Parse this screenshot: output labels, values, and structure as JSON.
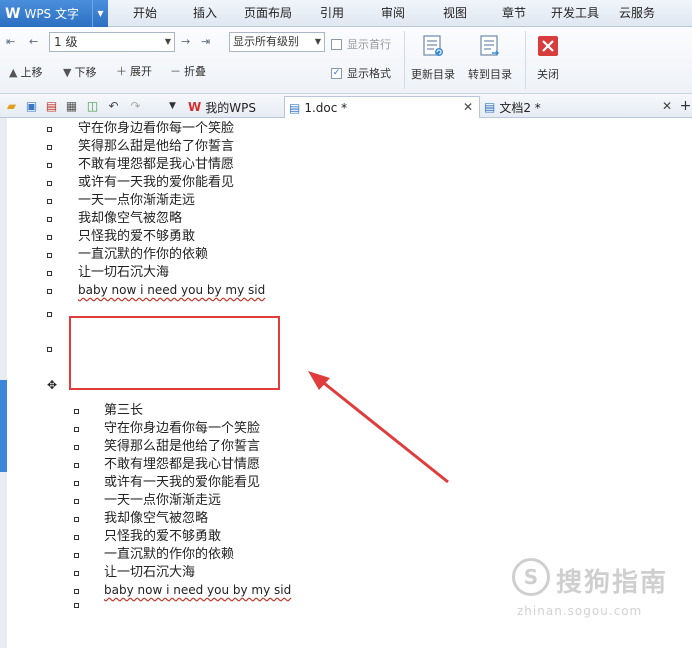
{
  "app": {
    "logo": "W",
    "title": "WPS 文字"
  },
  "menu": [
    "开始",
    "插入",
    "页面布局",
    "引用",
    "审阅",
    "视图",
    "章节",
    "开发工具",
    "云服务"
  ],
  "ribbon": {
    "level_value": "1 级",
    "show_level_value": "显示所有级别",
    "show_first_line": "显示首行",
    "show_format": "显示格式",
    "move_up": "上移",
    "move_down": "下移",
    "expand": "展开",
    "collapse": "折叠",
    "update_toc": "更新目录",
    "goto_toc": "转到目录",
    "close": "关闭"
  },
  "tabs": {
    "my_wps": "我的WPS",
    "doc1": "1.doc *",
    "doc2": "文档2 *"
  },
  "doc": {
    "block1": [
      "守在你身边看你每一个笑脸",
      "笑得那么甜是他给了你誓言",
      "不敢有埋怨都是我心甘情愿",
      "或许有一天我的爱你能看见",
      "一天一点你渐渐走远",
      "我却像空气被忽略",
      "只怪我的爱不够勇敢",
      "一直沉默的作你的依赖",
      "让一切石沉大海"
    ],
    "block1_eng": "baby now i need you by my sid",
    "block2": [
      "第三长",
      "守在你身边看你每一个笑脸",
      "笑得那么甜是他给了你誓言",
      "不敢有埋怨都是我心甘情愿",
      "或许有一天我的爱你能看见",
      "一天一点你渐渐走远",
      "我却像空气被忽略",
      "只怪我的爱不够勇敢",
      "一直沉默的作你的依赖",
      "让一切石沉大海"
    ],
    "block2_eng": "baby now i need you by my sid"
  },
  "watermark": {
    "text": "搜狗指南",
    "url": "zhinan.sogou.com"
  },
  "colors": {
    "accent": "#2c6fc2",
    "highlight": "#e03c3c"
  }
}
